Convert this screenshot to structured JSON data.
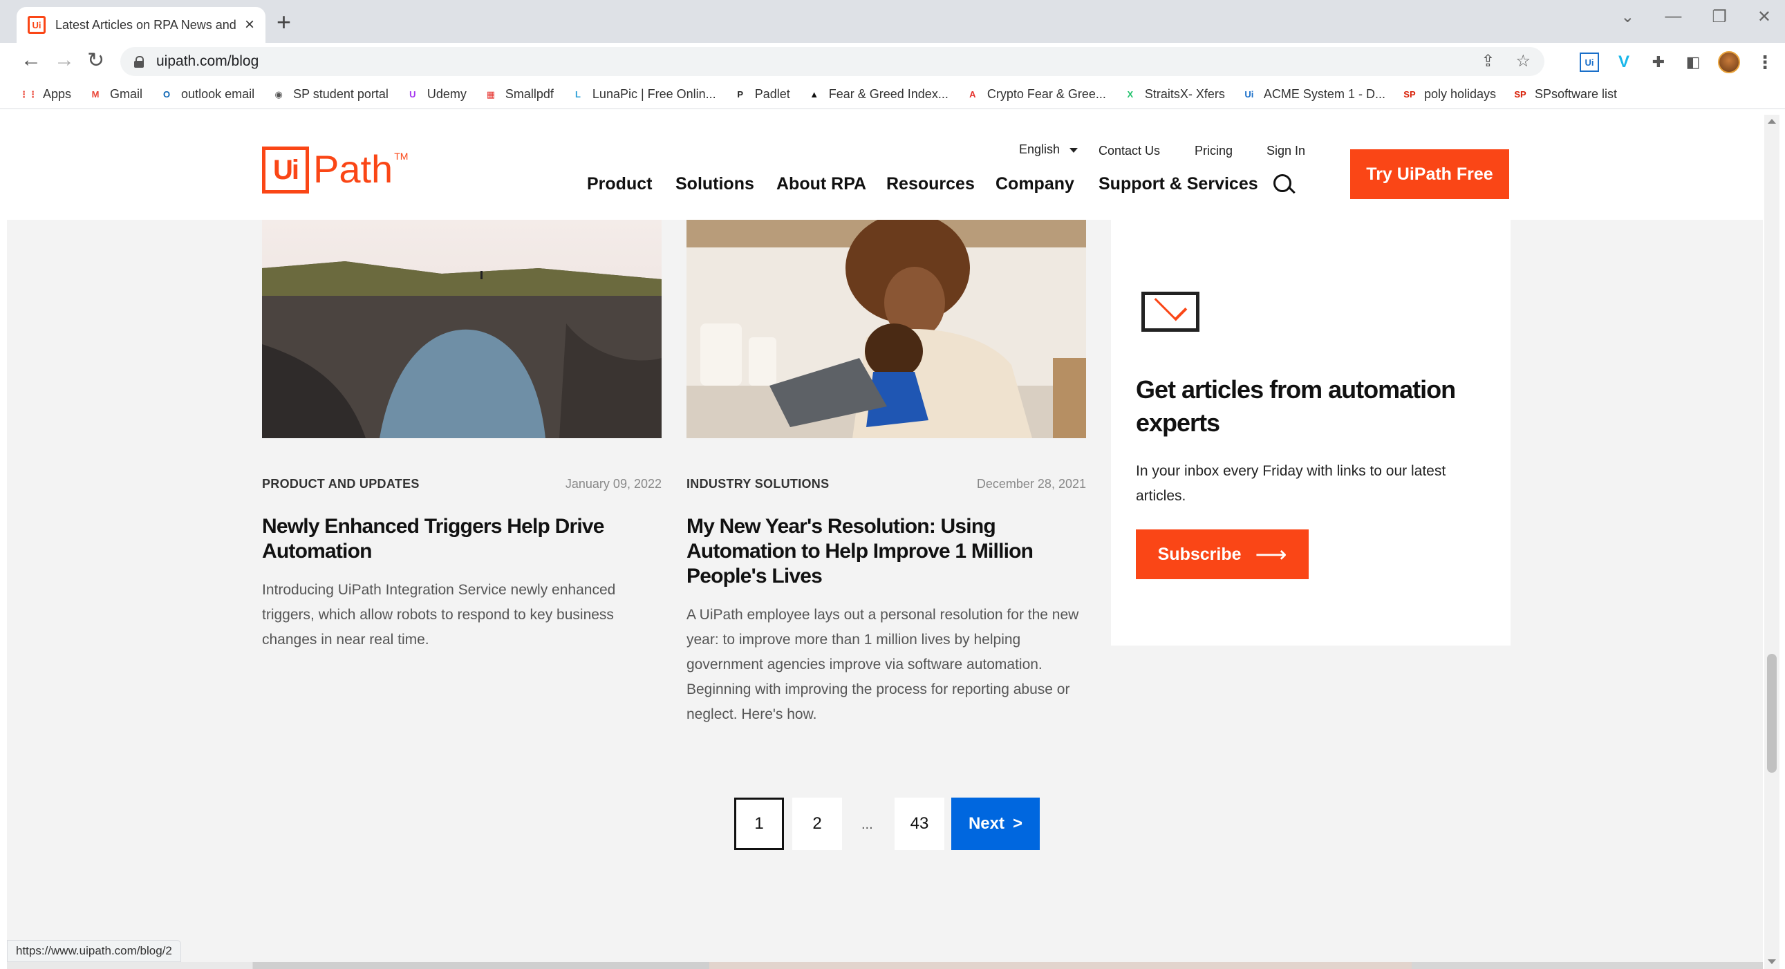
{
  "browser": {
    "tab_title": "Latest Articles on RPA News and",
    "favicon_text": "Ui",
    "url": "uipath.com/blog",
    "new_tab": "+",
    "tab_close": "×",
    "ext_uipath": "Ui",
    "ext_vimeo": "V",
    "bookmarks": [
      {
        "label": "Apps",
        "icon": "apps-grid-icon",
        "color": "#ea4335",
        "glyph": "⋮⋮"
      },
      {
        "label": "Gmail",
        "icon": "gmail-icon",
        "color": "#ea4335",
        "glyph": "M"
      },
      {
        "label": "outlook email",
        "icon": "outlook-icon",
        "color": "#0a64b4",
        "glyph": "O"
      },
      {
        "label": "SP student portal",
        "icon": "globe-icon",
        "color": "#555555",
        "glyph": "◉"
      },
      {
        "label": "Udemy",
        "icon": "udemy-icon",
        "color": "#a435f0",
        "glyph": "U"
      },
      {
        "label": "Smallpdf",
        "icon": "smallpdf-icon",
        "color": "#e5322d",
        "glyph": "▦"
      },
      {
        "label": "LunaPic | Free Onlin...",
        "icon": "lunapic-icon",
        "color": "#2b9fd6",
        "glyph": "L"
      },
      {
        "label": "Padlet",
        "icon": "padlet-icon",
        "color": "#222222",
        "glyph": "P"
      },
      {
        "label": "Fear & Greed Index...",
        "icon": "fear-greed-icon",
        "color": "#111111",
        "glyph": "▲"
      },
      {
        "label": "Crypto Fear & Gree...",
        "icon": "crypto-fear-icon",
        "color": "#e5322d",
        "glyph": "A"
      },
      {
        "label": "StraitsX- Xfers",
        "icon": "straitsx-icon",
        "color": "#1fc16b",
        "glyph": "X"
      },
      {
        "label": "ACME System 1 - D...",
        "icon": "acme-icon",
        "color": "#1a6fc9",
        "glyph": "Ui"
      },
      {
        "label": "poly holidays",
        "icon": "sp-icon",
        "color": "#d81e05",
        "glyph": "SP"
      },
      {
        "label": "SPsoftware list",
        "icon": "sp-icon",
        "color": "#d81e05",
        "glyph": "SP"
      }
    ]
  },
  "header": {
    "logo_ui": "Ui",
    "logo_path": "Path",
    "logo_tm": "TM",
    "language": "English",
    "contact": "Contact Us",
    "pricing": "Pricing",
    "signin": "Sign In",
    "nav": [
      "Product",
      "Solutions",
      "About RPA",
      "Resources",
      "Company",
      "Support & Services"
    ],
    "cta": "Try UiPath Free"
  },
  "articles": [
    {
      "category": "PRODUCT AND UPDATES",
      "date": "January 09, 2022",
      "title": "Newly Enhanced Triggers Help Drive Automation",
      "description": "Introducing UiPath Integration Service newly enhanced triggers, which allow robots to respond to key business changes in near real time."
    },
    {
      "category": "INDUSTRY SOLUTIONS",
      "date": "December 28, 2021",
      "title": "My New Year's Resolution: Using Automation to Help Improve 1 Million People's Lives",
      "description": "A UiPath employee lays out a personal resolution for the new year: to improve more than 1 million lives by helping government agencies improve via software automation. Beginning with improving the process for reporting abuse or neglect. Here's how."
    }
  ],
  "subscribe": {
    "heading": "Get articles from automation experts",
    "text": "In your inbox every Friday with links to our latest articles.",
    "button": "Subscribe"
  },
  "pagination": {
    "pages": [
      "1",
      "2",
      "43"
    ],
    "ellipsis": "...",
    "next": "Next",
    "next_arrow": ">"
  },
  "status_url": "https://www.uipath.com/blog/2",
  "colors": {
    "brand": "#fa4616",
    "next_button": "#0067df",
    "page_bg": "#f3f3f3"
  }
}
